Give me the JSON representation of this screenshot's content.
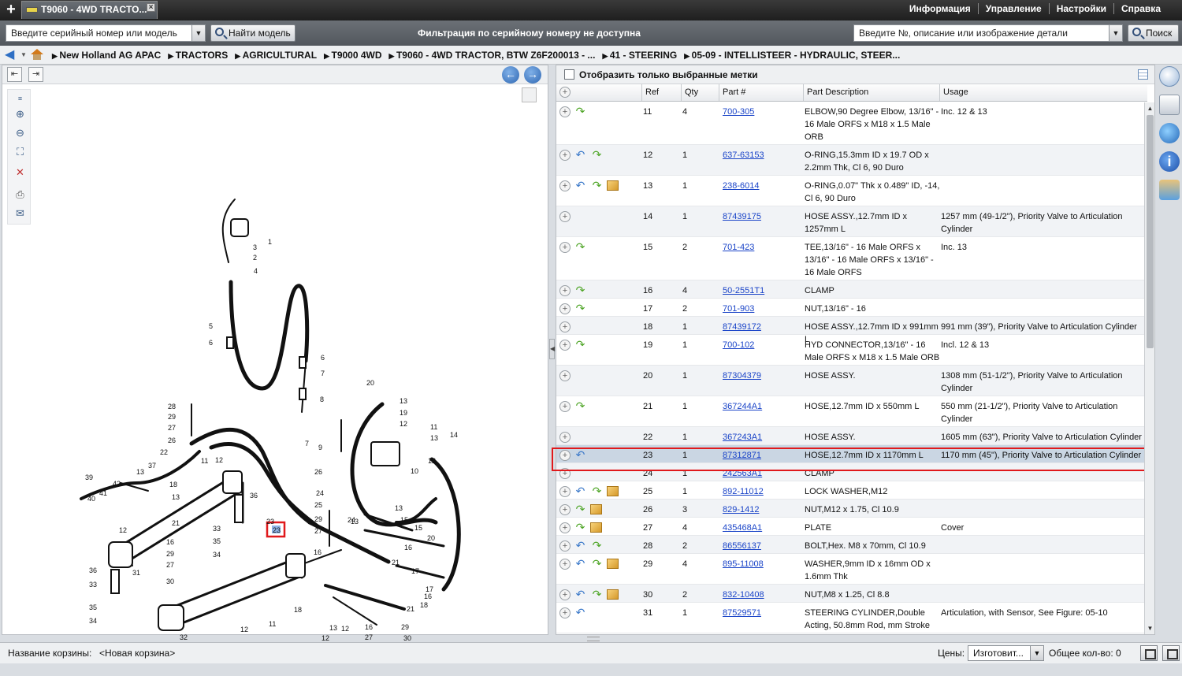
{
  "tab": {
    "title": "T9060 - 4WD TRACTO...",
    "close": "×"
  },
  "top_menu": [
    "Информация",
    "Управление",
    "Настройки",
    "Справка"
  ],
  "search": {
    "serial_placeholder": "Введите серийный номер или модель",
    "find_model": "Найти модель",
    "filter_message": "Фильтрация по серийному номеру не доступна",
    "part_placeholder": "Введите №, описание или изображение детали",
    "search_button": "Поиск"
  },
  "breadcrumb": [
    "New Holland AG APAC",
    "TRACTORS",
    "AGRICULTURAL",
    "T9000 4WD",
    "T9060 - 4WD TRACTOR, BTW Z6F200013 - ...",
    "41 - STEERING",
    "05-09 - INTELLISTEER - HYDRAULIC, STEER..."
  ],
  "parts_panel": {
    "checkbox_label": "Отобразить только выбранные метки",
    "columns": {
      "ref": "Ref",
      "qty": "Qty",
      "part": "Part #",
      "desc": "Part Description",
      "usage": "Usage"
    }
  },
  "parts": [
    {
      "ref": "11",
      "qty": "4",
      "part": "700-305",
      "desc": "ELBOW,90 Degree Elbow, 13/16\" - 16 Male ORFS x M18 x 1.5 Male ORB",
      "usage": "Inc. 12 & 13",
      "icons": [
        "green"
      ]
    },
    {
      "ref": "12",
      "qty": "1",
      "part": "637-63153",
      "desc": "O-RING,15.3mm ID x 19.7 OD x 2.2mm Thk, Cl 6, 90 Duro",
      "usage": "",
      "icons": [
        "blue",
        "green"
      ]
    },
    {
      "ref": "13",
      "qty": "1",
      "part": "238-6014",
      "desc": "O-RING,0.07\" Thk x 0.489\" ID, -14, Cl 6, 90 Duro",
      "usage": "",
      "icons": [
        "blue",
        "green",
        "box"
      ]
    },
    {
      "ref": "14",
      "qty": "1",
      "part": "87439175",
      "desc": "HOSE ASSY.,12.7mm ID x 1257mm L",
      "usage": "1257 mm (49-1/2\"), Priority Valve to Articulation Cylinder",
      "icons": []
    },
    {
      "ref": "15",
      "qty": "2",
      "part": "701-423",
      "desc": "TEE,13/16\" - 16 Male ORFS x 13/16\" - 16 Male ORFS x 13/16\" - 16 Male ORFS",
      "usage": "Inc. 13",
      "icons": [
        "green"
      ]
    },
    {
      "ref": "16",
      "qty": "4",
      "part": "50-2551T1",
      "desc": "CLAMP",
      "usage": "",
      "icons": [
        "green"
      ]
    },
    {
      "ref": "17",
      "qty": "2",
      "part": "701-903",
      "desc": "NUT,13/16\" - 16",
      "usage": "",
      "icons": [
        "green"
      ]
    },
    {
      "ref": "18",
      "qty": "1",
      "part": "87439172",
      "desc": "HOSE ASSY.,12.7mm ID x 991mm L",
      "usage": "991 mm (39\"), Priority Valve to Articulation Cylinder",
      "icons": []
    },
    {
      "ref": "19",
      "qty": "1",
      "part": "700-102",
      "desc": "HYD CONNECTOR,13/16\" - 16 Male ORFS x M18 x 1.5 Male ORB",
      "usage": "Incl. 12 & 13",
      "icons": [
        "green"
      ]
    },
    {
      "ref": "20",
      "qty": "1",
      "part": "87304379",
      "desc": "HOSE ASSY.",
      "usage": "1308 mm (51-1/2\"), Priority Valve to Articulation Cylinder",
      "icons": []
    },
    {
      "ref": "21",
      "qty": "1",
      "part": "367244A1",
      "desc": "HOSE,12.7mm ID x 550mm L",
      "usage": "550 mm (21-1/2\"), Priority Valve to Articulation Cylinder",
      "icons": [
        "green"
      ]
    },
    {
      "ref": "22",
      "qty": "1",
      "part": "367243A1",
      "desc": "HOSE ASSY.",
      "usage": "1605 mm (63\"), Priority Valve to Articulation Cylinder",
      "icons": []
    },
    {
      "ref": "23",
      "qty": "1",
      "part": "87312871",
      "desc": "HOSE,12.7mm ID x 1170mm L",
      "usage": "1170 mm (45\"), Priority Valve to Articulation Cylinder",
      "icons": [
        "blue"
      ],
      "selected": true
    },
    {
      "ref": "24",
      "qty": "1",
      "part": "242563A1",
      "desc": "CLAMP",
      "usage": "",
      "icons": []
    },
    {
      "ref": "25",
      "qty": "1",
      "part": "892-11012",
      "desc": "LOCK WASHER,M12",
      "usage": "",
      "icons": [
        "blue",
        "green",
        "box"
      ]
    },
    {
      "ref": "26",
      "qty": "3",
      "part": "829-1412",
      "desc": "NUT,M12 x 1.75, Cl 10.9",
      "usage": "",
      "icons": [
        "green",
        "box"
      ]
    },
    {
      "ref": "27",
      "qty": "4",
      "part": "435468A1",
      "desc": "PLATE",
      "usage": "Cover",
      "icons": [
        "green",
        "box"
      ]
    },
    {
      "ref": "28",
      "qty": "2",
      "part": "86556137",
      "desc": "BOLT,Hex. M8 x 70mm, Cl 10.9",
      "usage": "",
      "icons": [
        "blue",
        "green"
      ]
    },
    {
      "ref": "29",
      "qty": "4",
      "part": "895-11008",
      "desc": "WASHER,9mm ID x 16mm OD x 1.6mm Thk",
      "usage": "",
      "icons": [
        "blue",
        "green",
        "box"
      ]
    },
    {
      "ref": "30",
      "qty": "2",
      "part": "832-10408",
      "desc": "NUT,M8 x 1.25, Cl 8.8",
      "usage": "",
      "icons": [
        "blue",
        "green",
        "box"
      ]
    },
    {
      "ref": "31",
      "qty": "1",
      "part": "87529571",
      "desc": "STEERING CYLINDER,Double Acting, 50.8mm Rod, mm Stroke",
      "usage": "Articulation, with Sensor, See Figure: 05-10",
      "icons": [
        "blue"
      ]
    }
  ],
  "diagram": {
    "selected_ref": "23",
    "callouts": [
      "1",
      "3",
      "2",
      "4",
      "5",
      "6",
      "6",
      "7",
      "8",
      "9",
      "7",
      "20",
      "13",
      "19",
      "12",
      "11",
      "13",
      "14",
      "12",
      "10",
      "28",
      "29",
      "27",
      "26",
      "22",
      "37",
      "11",
      "12",
      "39",
      "42",
      "13",
      "41",
      "40",
      "12",
      "18",
      "13",
      "21",
      "36",
      "33",
      "35",
      "34",
      "16",
      "29",
      "27",
      "30",
      "31",
      "36",
      "33",
      "35",
      "34",
      "32",
      "12",
      "11",
      "18",
      "12",
      "13",
      "12",
      "16",
      "27",
      "29",
      "30",
      "17",
      "26",
      "24",
      "25",
      "29",
      "27",
      "16",
      "24",
      "21",
      "13",
      "15",
      "20",
      "13",
      "15",
      "16",
      "17",
      "18",
      "21",
      "16",
      "23"
    ]
  },
  "footer": {
    "cart_label": "Название корзины:",
    "cart_name": "<Новая корзина>",
    "price_label": "Цены:",
    "price_value": "Изготовит...",
    "total": "Общее кол-во: 0"
  }
}
